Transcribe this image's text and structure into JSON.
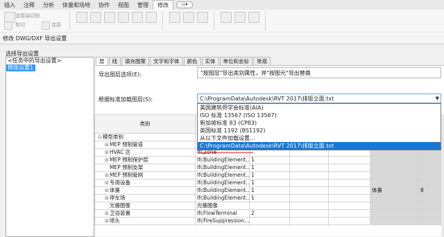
{
  "ribbon": {
    "tabs": [
      "插入",
      "注释",
      "分析",
      "体量和场地",
      "协作",
      "视图",
      "管理",
      "修改"
    ],
    "active_tab": "修改",
    "tools": [
      "连接端切割",
      "剪切",
      "连接"
    ]
  },
  "modify_bar": {
    "title": "修改 DWG/DXF 导出设置"
  },
  "left_panel": {
    "heading": "选择导出设置",
    "items": [
      "<任务中的导出设置>",
      "修改设置1"
    ]
  },
  "dialog_tabs": [
    "层",
    "线",
    "填充图案",
    "文字和字体",
    "颜色",
    "实体",
    "单位和坐标",
    "常规"
  ],
  "layer_options": {
    "label": "导出图层选项(E):",
    "value": "\"按图层\"导出类别属性，并\"按图元\"导出替换"
  },
  "layer_standard": {
    "label": "根据标准加载图层(S):",
    "value": "C:\\ProgramData\\Autodesk\\RVT 2017\\排版立面.txt",
    "options": [
      "美国建筑师学会标准(AIA)",
      "ISO 标准 13567 (ISO 13567)",
      "新加坡标准 83 (CP83)",
      "英国标准 1192 (BS1192)",
      "从以下文件加载设置...",
      "C:\\ProgramData\\Autodesk\\RVT 2017\\排版立面.txt"
    ],
    "selected_index": 5
  },
  "grid": {
    "header_category": "类别",
    "rows": [
      {
        "name": "模型类别",
        "indent": 0,
        "expand": "−",
        "layer": "",
        "color": "",
        "extra": ""
      },
      {
        "name": "MEP 预制管道",
        "indent": 1,
        "expand": "+",
        "layer": "",
        "color": "",
        "extra": ""
      },
      {
        "name": "HVAC 区",
        "indent": 1,
        "expand": "+",
        "layer": "IfcZone",
        "color": "",
        "extra": ""
      },
      {
        "name": "MEP 预制保护层",
        "indent": 1,
        "expand": "+",
        "layer": "IfcBuildingElement...",
        "color": "1",
        "extra": ""
      },
      {
        "name": "MEP 预制支架",
        "indent": 1,
        "expand": "",
        "layer": "IfcBuildingElement...",
        "color": "1",
        "extra": ""
      },
      {
        "name": "MEP 预制管网",
        "indent": 1,
        "expand": "+",
        "layer": "IfcBuildingElement...",
        "color": "1",
        "extra": ""
      },
      {
        "name": "专用设备",
        "indent": 1,
        "expand": "+",
        "layer": "IfcBuildingElement...",
        "color": "1",
        "extra": ""
      },
      {
        "name": "体量",
        "indent": 1,
        "expand": "+",
        "layer": "IfcBuildingElement...",
        "color": "1",
        "extra": "体量",
        "extra2": "8"
      },
      {
        "name": "停车场",
        "indent": 1,
        "expand": "+",
        "layer": "IfcBuildingElement...",
        "color": "1",
        "extra": ""
      },
      {
        "name": "光栅图像",
        "indent": 1,
        "expand": "",
        "layer": "光栅图像",
        "color": "",
        "extra": ""
      },
      {
        "name": "卫浴装置",
        "indent": 1,
        "expand": "+",
        "layer": "IfcFlowTerminal",
        "color": "2",
        "extra": ""
      },
      {
        "name": "喷头",
        "indent": 1,
        "expand": "+",
        "layer": "IfcFireSuppression...",
        "color": "",
        "extra": ""
      }
    ]
  }
}
